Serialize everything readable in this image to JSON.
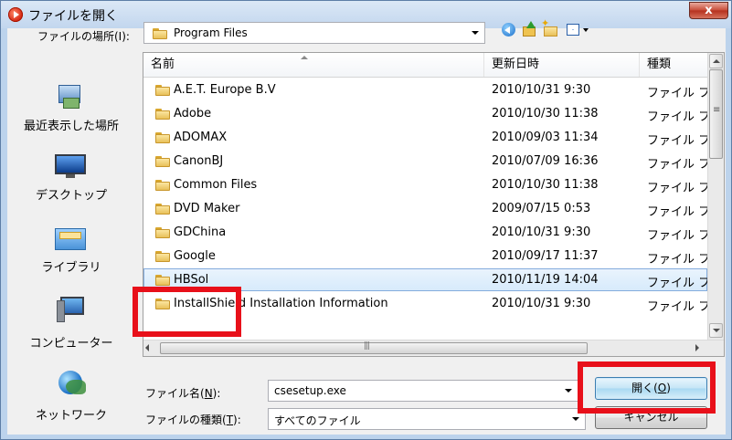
{
  "window": {
    "title": "ファイルを開く",
    "close_label": "x"
  },
  "lookin": {
    "label": "ファイルの場所(I):",
    "value": "Program Files"
  },
  "places": [
    {
      "label": "最近表示した場所",
      "icon": "recent-places-icon"
    },
    {
      "label": "デスクトップ",
      "icon": "desktop-icon"
    },
    {
      "label": "ライブラリ",
      "icon": "libraries-icon"
    },
    {
      "label": "コンピューター",
      "icon": "computer-icon"
    },
    {
      "label": "ネットワーク",
      "icon": "network-icon"
    }
  ],
  "columns": {
    "name": "名前",
    "date": "更新日時",
    "type": "種類"
  },
  "files": [
    {
      "name": "A.E.T. Europe B.V",
      "date": "2010/10/31 9:30",
      "type": "ファイル フ"
    },
    {
      "name": "Adobe",
      "date": "2010/10/30 11:38",
      "type": "ファイル フ"
    },
    {
      "name": "ADOMAX",
      "date": "2010/09/03 11:34",
      "type": "ファイル フ"
    },
    {
      "name": "CanonBJ",
      "date": "2010/07/09 16:36",
      "type": "ファイル フ"
    },
    {
      "name": "Common Files",
      "date": "2010/10/30 11:38",
      "type": "ファイル フ"
    },
    {
      "name": "DVD Maker",
      "date": "2009/07/15 0:53",
      "type": "ファイル フ"
    },
    {
      "name": "GDChina",
      "date": "2010/10/31 9:30",
      "type": "ファイル フ"
    },
    {
      "name": "Google",
      "date": "2010/09/17 11:37",
      "type": "ファイル フ"
    },
    {
      "name": "HBSol",
      "date": "2010/11/19 14:04",
      "type": "ファイル フ"
    },
    {
      "name": "InstallShield Installation Information",
      "date": "2010/10/31 9:30",
      "type": "ファイル フ"
    }
  ],
  "selected_file": "HBSol",
  "filename": {
    "label_text": "ファイル名(",
    "label_key": "N",
    "label_end": "):",
    "value": "csesetup.exe"
  },
  "filetype": {
    "label_text": "ファイルの種類(",
    "label_key": "T",
    "label_end": "):",
    "value": "すべてのファイル"
  },
  "buttons": {
    "open_text": "開く(",
    "open_key": "O",
    "open_end": ")",
    "cancel": "キャンセル"
  },
  "colors": {
    "highlight": "#e8101a",
    "selection": "#d6eafb",
    "frame": "#bcd3ec"
  },
  "annotations": [
    "hbsol-folder-row",
    "open-button"
  ]
}
